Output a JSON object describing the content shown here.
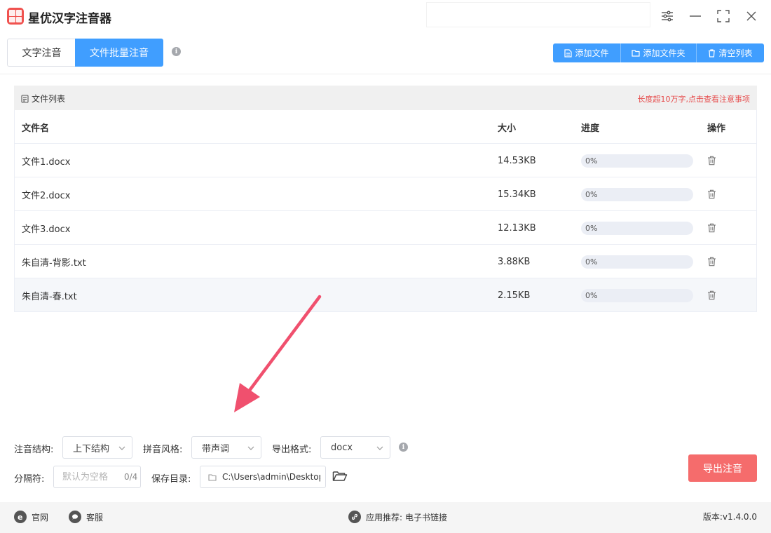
{
  "app": {
    "title": "星优汉字注音器"
  },
  "tabs": [
    {
      "label": "文字注音",
      "active": false
    },
    {
      "label": "文件批量注音",
      "active": true
    }
  ],
  "toolbar": {
    "add_file": "添加文件",
    "add_folder": "添加文件夹",
    "clear_list": "清空列表"
  },
  "file_list": {
    "title": "文件列表",
    "warning": "长度超10万字,点击查看注意事项",
    "columns": {
      "name": "文件名",
      "size": "大小",
      "progress": "进度",
      "action": "操作"
    },
    "rows": [
      {
        "name": "文件1.docx",
        "size": "14.53KB",
        "progress_label": "0%",
        "progress": 0
      },
      {
        "name": "文件2.docx",
        "size": "15.34KB",
        "progress_label": "0%",
        "progress": 0
      },
      {
        "name": "文件3.docx",
        "size": "12.13KB",
        "progress_label": "0%",
        "progress": 0
      },
      {
        "name": "朱自清-背影.txt",
        "size": "3.88KB",
        "progress_label": "0%",
        "progress": 0
      },
      {
        "name": "朱自清-春.txt",
        "size": "2.15KB",
        "progress_label": "0%",
        "progress": 0
      }
    ]
  },
  "settings": {
    "structure_label": "注音结构:",
    "structure_value": "上下结构",
    "style_label": "拼音风格:",
    "style_value": "带声调",
    "format_label": "导出格式:",
    "format_value": "docx",
    "separator_label": "分隔符:",
    "separator_placeholder": "默认为空格",
    "separator_count": "0/4",
    "save_dir_label": "保存目录:",
    "save_dir_value": "C:\\Users\\admin\\Desktop"
  },
  "export_button": "导出注音",
  "footer": {
    "website": "官网",
    "service": "客服",
    "recommend_label": "应用推荐:",
    "recommend_link": "电子书链接",
    "version": "版本:v1.4.0.0"
  },
  "colors": {
    "primary": "#409eff",
    "export": "#f56c6c",
    "warning": "#e64c4c",
    "arrow": "#f0506e"
  }
}
